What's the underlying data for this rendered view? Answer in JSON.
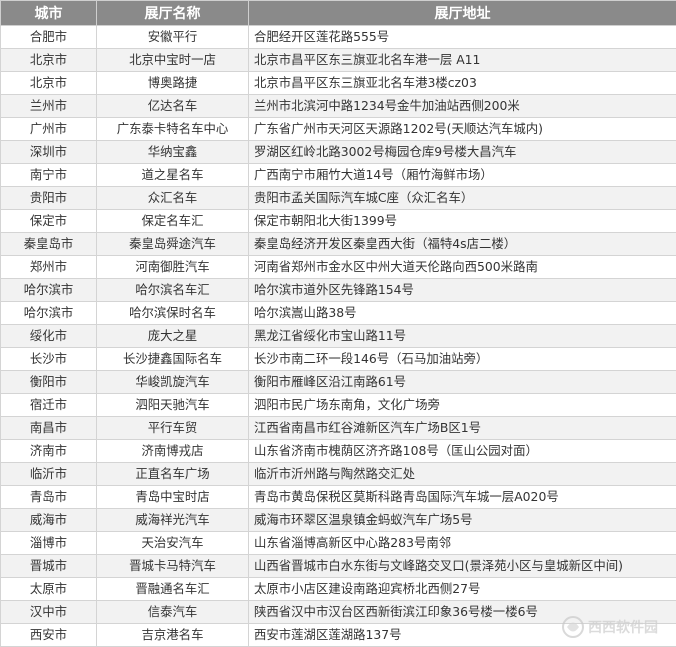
{
  "header": {
    "city": "城市",
    "hall": "展厅名称",
    "addr": "展厅地址"
  },
  "rows": [
    {
      "city": "合肥市",
      "hall": "安徽平行",
      "addr": "合肥经开区莲花路555号"
    },
    {
      "city": "北京市",
      "hall": "北京中宝时一店",
      "addr": "北京市昌平区东三旗亚北名车港一层 A11"
    },
    {
      "city": "北京市",
      "hall": "博奥路捷",
      "addr": "北京市昌平区东三旗亚北名车港3楼cz03"
    },
    {
      "city": "兰州市",
      "hall": "亿达名车",
      "addr": "兰州市北滨河中路1234号金牛加油站西侧200米"
    },
    {
      "city": "广州市",
      "hall": "广东泰卡特名车中心",
      "addr": "广东省广州市天河区天源路1202号(天顺达汽车城内)"
    },
    {
      "city": "深圳市",
      "hall": "华纳宝鑫",
      "addr": "罗湖区红岭北路3002号梅园仓库9号楼大昌汽车"
    },
    {
      "city": "南宁市",
      "hall": "道之星名车",
      "addr": "广西南宁市厢竹大道14号（厢竹海鲜市场）"
    },
    {
      "city": "贵阳市",
      "hall": "众汇名车",
      "addr": "贵阳市孟关国际汽车城C座（众汇名车）"
    },
    {
      "city": "保定市",
      "hall": "保定名车汇",
      "addr": "保定市朝阳北大街1399号"
    },
    {
      "city": "秦皇岛市",
      "hall": "秦皇岛舜途汽车",
      "addr": "秦皇岛经济开发区秦皇西大街（福特4s店二楼）"
    },
    {
      "city": "郑州市",
      "hall": "河南御胜汽车",
      "addr": "河南省郑州市金水区中州大道天伦路向西500米路南"
    },
    {
      "city": "哈尔滨市",
      "hall": "哈尔滨名车汇",
      "addr": "哈尔滨市道外区先锋路154号"
    },
    {
      "city": "哈尔滨市",
      "hall": "哈尔滨保时名车",
      "addr": "哈尔滨嵩山路38号"
    },
    {
      "city": "绥化市",
      "hall": "庞大之星",
      "addr": "黑龙江省绥化市宝山路11号"
    },
    {
      "city": "长沙市",
      "hall": "长沙捷鑫国际名车",
      "addr": "长沙市南二环一段146号（石马加油站旁）"
    },
    {
      "city": "衡阳市",
      "hall": "华峻凯旋汽车",
      "addr": "衡阳市雁峰区沿江南路61号"
    },
    {
      "city": "宿迁市",
      "hall": "泗阳天驰汽车",
      "addr": "泗阳市民广场东南角，文化广场旁"
    },
    {
      "city": "南昌市",
      "hall": "平行车贸",
      "addr": "江西省南昌市红谷滩新区汽车广场B区1号"
    },
    {
      "city": "济南市",
      "hall": "济南博戎店",
      "addr": "山东省济南市槐荫区济齐路108号（匡山公园对面）"
    },
    {
      "city": "临沂市",
      "hall": "正直名车广场",
      "addr": "临沂市沂州路与陶然路交汇处"
    },
    {
      "city": "青岛市",
      "hall": "青岛中宝时店",
      "addr": "青岛市黄岛保税区莫斯科路青岛国际汽车城一层A020号"
    },
    {
      "city": "威海市",
      "hall": "威海祥光汽车",
      "addr": "威海市环翠区温泉镇金蚂蚁汽车广场5号"
    },
    {
      "city": "淄博市",
      "hall": "天治安汽车",
      "addr": "山东省淄博高新区中心路283号南邻"
    },
    {
      "city": "晋城市",
      "hall": "晋城卡马特汽车",
      "addr": "山西省晋城市白水东街与文峰路交叉口(景泽苑小区与皇城新区中间)"
    },
    {
      "city": "太原市",
      "hall": "晋融通名车汇",
      "addr": "太原市小店区建设南路迎宾桥北西侧27号"
    },
    {
      "city": "汉中市",
      "hall": "信泰汽车",
      "addr": "陕西省汉中市汉台区西新街滨江印象36号楼一楼6号"
    },
    {
      "city": "西安市",
      "hall": "吉京港名车",
      "addr": "西安市莲湖区莲湖路137号"
    }
  ],
  "colors": {
    "header_bg": "#8a8a8a",
    "alt_row_bg": "#f2f2f2",
    "border": "#d4d4d4",
    "text": "#333333"
  },
  "watermark": {
    "icon": "watermark-logo-icon",
    "text": "西西软件园"
  }
}
